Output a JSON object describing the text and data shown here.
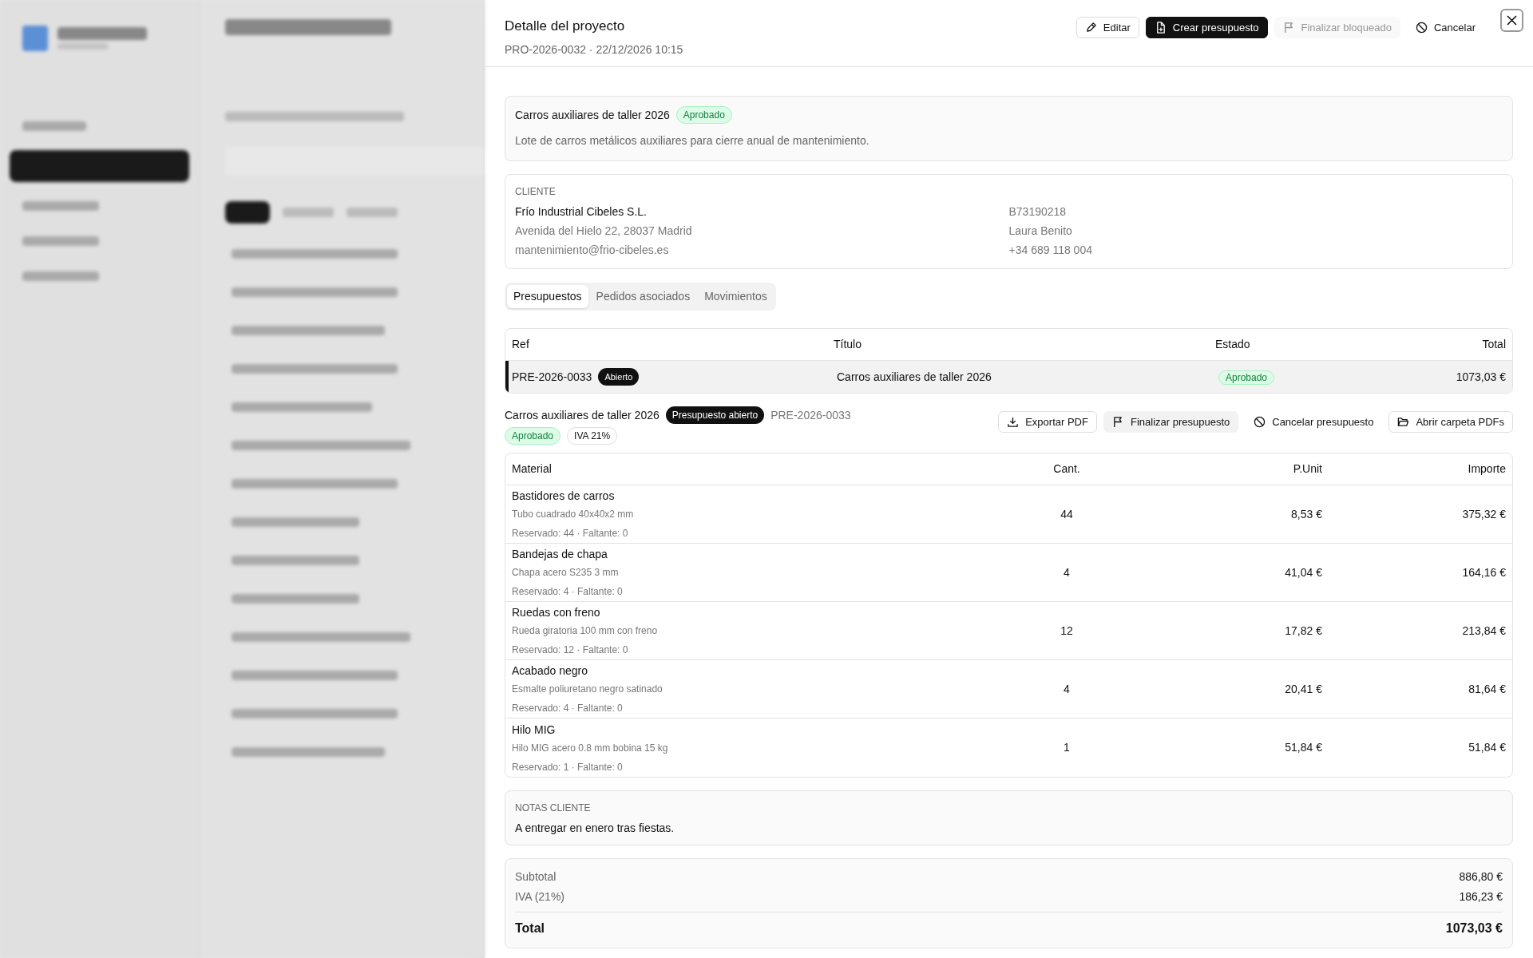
{
  "header": {
    "title": "Detalle del proyecto",
    "subtitle": "PRO-2026-0032 · 22/12/2026 10:15",
    "actions": [
      {
        "kind": "outline",
        "label": "Editar",
        "disabled": false
      },
      {
        "kind": "primary",
        "label": "Crear presupuesto",
        "disabled": false
      },
      {
        "kind": "muted",
        "label": "Finalizar bloqueado",
        "disabled": true
      },
      {
        "kind": "ghost",
        "label": "Cancelar",
        "disabled": false
      }
    ]
  },
  "project": {
    "name": "Carros auxiliares de taller 2026",
    "status": "Aprobado",
    "description": "Lote de carros metálicos auxiliares para cierre anual de mantenimiento."
  },
  "client": {
    "heading": "CLIENTE",
    "name": "Frío Industrial Cibeles S.L.",
    "address": "Avenida del Hielo 22, 28037 Madrid",
    "email": "mantenimiento@frio-cibeles.es",
    "tax_id": "B73190218",
    "contact": "Laura Benito",
    "phone": "+34 689 118 004"
  },
  "tabs": [
    {
      "label": "Presupuestos",
      "selected": true
    },
    {
      "label": "Pedidos asociados",
      "selected": false
    },
    {
      "label": "Movimientos",
      "selected": false
    }
  ],
  "quotes_table": {
    "columns": [
      "Ref",
      "Título",
      "Estado",
      "Total"
    ],
    "rows": [
      {
        "ref": "PRE-2026-0033",
        "badge": "Abierto",
        "title": "Carros auxiliares de taller 2026",
        "status": "Aprobado",
        "total": "1073,03 €",
        "selected": true
      }
    ]
  },
  "quote": {
    "title": "Carros auxiliares de taller 2026",
    "badge": "Presupuesto abierto",
    "ref": "PRE-2026-0033",
    "status": "Aprobado",
    "tax": "IVA 21%",
    "actions": [
      {
        "kind": "outline",
        "label": "Exportar PDF"
      },
      {
        "kind": "muted",
        "label": "Finalizar presupuesto"
      },
      {
        "kind": "ghost",
        "label": "Cancelar presupuesto"
      },
      {
        "kind": "outline",
        "label": "Abrir carpeta PDFs"
      }
    ]
  },
  "materials_table": {
    "columns": [
      "Material",
      "Cant.",
      "P.Unit",
      "Importe"
    ],
    "rows": [
      {
        "name": "Bastidores de carros",
        "spec": "Tubo cuadrado 40x40x2 mm",
        "stock": "Reservado: 44 · Faltante: 0",
        "qty": "44",
        "unit": "8,53 €",
        "amount": "375,32 €"
      },
      {
        "name": "Bandejas de chapa",
        "spec": "Chapa acero S235 3 mm",
        "stock": "Reservado: 4 · Faltante: 0",
        "qty": "4",
        "unit": "41,04 €",
        "amount": "164,16 €"
      },
      {
        "name": "Ruedas con freno",
        "spec": "Rueda giratoria 100 mm con freno",
        "stock": "Reservado: 12 · Faltante: 0",
        "qty": "12",
        "unit": "17,82 €",
        "amount": "213,84 €"
      },
      {
        "name": "Acabado negro",
        "spec": "Esmalte poliuretano negro satinado",
        "stock": "Reservado: 4 · Faltante: 0",
        "qty": "4",
        "unit": "20,41 €",
        "amount": "81,64 €"
      },
      {
        "name": "Hilo MIG",
        "spec": "Hilo MIG acero 0.8 mm bobina 15 kg",
        "stock": "Reservado: 1 · Faltante: 0",
        "qty": "1",
        "unit": "51,84 €",
        "amount": "51,84 €"
      }
    ]
  },
  "notes": {
    "heading": "NOTAS CLIENTE",
    "text": "A entregar en enero tras fiestas."
  },
  "totals": {
    "subtotal_label": "Subtotal",
    "subtotal": "886,80 €",
    "tax_label": "IVA (21%)",
    "tax": "186,23 €",
    "total_label": "Total",
    "total": "1073,03 €"
  }
}
